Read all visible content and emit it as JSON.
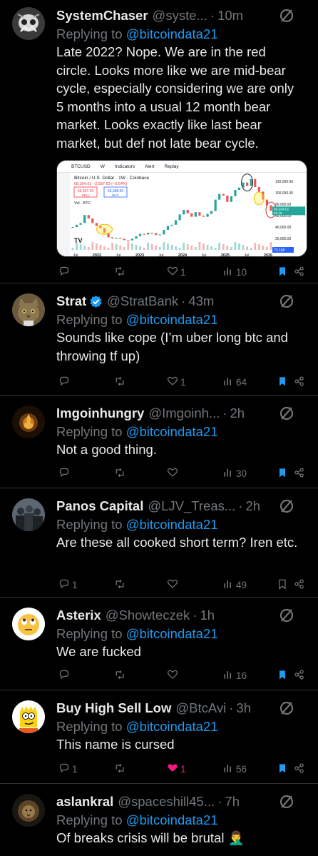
{
  "colors": {
    "background": "#000000",
    "text": "#e7e9ea",
    "muted": "#71767b",
    "link": "#1d9bf0",
    "like": "#f91880",
    "divider": "#2f3336",
    "verified": "#1d9bf0"
  },
  "replies": [
    {
      "name": "SystemChaser",
      "handle": "@syste...",
      "time": "10m",
      "verified": false,
      "replying_prefix": "Replying to ",
      "replying_to": "@bitcoindata21",
      "text": "Late 2022? Nope. We are in the red circle. Looks more like we are mid-bear cycle, especially considering we are only 5 months into a usual 12 month bear market. Looks exactly like last bear market, but def not late bear cycle.",
      "comments": "",
      "retweets": "",
      "likes": "1",
      "views": "10",
      "liked": false,
      "bookmarked": true,
      "avatar_icon": "skull-avatar-icon",
      "has_media": true
    },
    {
      "name": "Strat",
      "handle": "@StratBank",
      "time": "43m",
      "verified": true,
      "replying_prefix": "Replying to ",
      "replying_to": "@bitcoindata21",
      "text": "Sounds like cope (I’m uber long btc and throwing tf up)",
      "comments": "",
      "retweets": "",
      "likes": "1",
      "views": "64",
      "liked": false,
      "bookmarked": true,
      "avatar_icon": "cat-avatar-icon"
    },
    {
      "name": "Imgoinhungry",
      "handle": "@Imgoinh...",
      "time": "2h",
      "verified": false,
      "replying_prefix": "Replying to ",
      "replying_to": "@bitcoindata21",
      "text": "Not a good thing.",
      "comments": "",
      "retweets": "",
      "likes": "",
      "views": "30",
      "liked": false,
      "bookmarked": true,
      "avatar_icon": "fire-avatar-icon"
    },
    {
      "name": "Panos Capital",
      "handle": "@LJV_Treas...",
      "time": "2h",
      "verified": false,
      "replying_prefix": "Replying to ",
      "replying_to": "@bitcoindata21",
      "text": "Are these all cooked short term? Iren etc.",
      "comments": "1",
      "retweets": "",
      "likes": "",
      "views": "49",
      "liked": false,
      "bookmarked": false,
      "avatar_icon": "crowd-avatar-icon"
    },
    {
      "name": "Asterix",
      "handle": "@Showteczek",
      "time": "1h",
      "verified": false,
      "replying_prefix": "Replying to ",
      "replying_to": "@bitcoindata21",
      "text": "We are fucked",
      "comments": "",
      "retweets": "",
      "likes": "",
      "views": "16",
      "liked": false,
      "bookmarked": true,
      "avatar_icon": "eye-roll-emoji-avatar-icon"
    },
    {
      "name": "Buy High Sell Low",
      "handle": "@BtcAvi",
      "time": "3h",
      "verified": false,
      "replying_prefix": "Replying to ",
      "replying_to": "@bitcoindata21",
      "text": "This name is cursed",
      "comments": "1",
      "retweets": "",
      "likes": "1",
      "views": "56",
      "liked": true,
      "bookmarked": true,
      "avatar_icon": "bart-avatar-icon"
    },
    {
      "name": "aslankral",
      "handle": "@spaceshill45...",
      "time": "7h",
      "verified": false,
      "replying_prefix": "Replying to ",
      "replying_to": "@bitcoindata21",
      "text": "Of breaks crisis will be brutal 🤦‍♂️",
      "comments": "",
      "retweets": "",
      "likes": "",
      "views": "",
      "liked": false,
      "bookmarked": false,
      "avatar_icon": "lion-avatar-icon"
    }
  ],
  "chart_card": {
    "symbol": "BTCUSD",
    "interval": "W",
    "indicators_label": "Indicators",
    "alert_label": "Alert",
    "replay_label": "Replay",
    "title": "Bitcoin / U.S. Dollar · 1W · Coinbase",
    "price_line": "68,304.01 −2,587.63 (−3.64%)",
    "sell_price": "66,307.36",
    "sell_label": "SELL",
    "buy_price": "66,308.95",
    "buy_label": "BUY",
    "volume_label": "Vol · BTC",
    "last_price_label": "68,304.01",
    "last_price_sub": "2d 16",
    "low_price_label": "73.16K",
    "chart_data": {
      "type": "line",
      "title": "Bitcoin / U.S. Dollar · 1W · Coinbase",
      "x": [
        "Jul",
        "2022",
        "Jul",
        "2023",
        "Jul",
        "2024",
        "Jul",
        "2025",
        "Jul",
        "2026"
      ],
      "y_ticks": [
        "120,000.00",
        "100,000.00",
        "80,000.00",
        "60,000.00",
        "40,000.00",
        "20,000.00"
      ],
      "ylim": [
        0,
        130000
      ],
      "series": [
        {
          "values": [
            40000,
            44000,
            47000,
            61000,
            55000,
            47000,
            42000,
            38000,
            30000,
            22000,
            20000,
            21000,
            19500,
            17000,
            16500,
            19500,
            24000,
            28000,
            27000,
            30000,
            29000,
            26000,
            27000,
            35000,
            42000,
            44000,
            52000,
            62000,
            70000,
            64000,
            58000,
            66000,
            60000,
            58000,
            63000,
            68000,
            88000,
            98000,
            95000,
            84000,
            94000,
            105000,
            109000,
            118000,
            112000,
            124000,
            110000,
            102000,
            88000,
            78000,
            68300
          ]
        }
      ]
    }
  }
}
